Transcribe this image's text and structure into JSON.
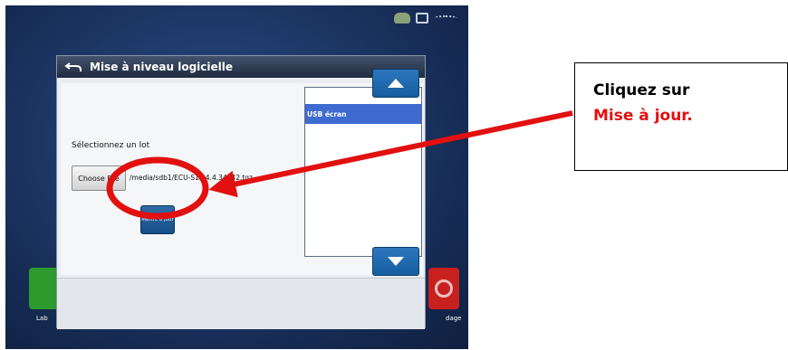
{
  "dialog": {
    "title": "Mise à niveau logicielle",
    "select_label": "Sélectionnez un lot",
    "choose_file_label": "Choose File",
    "file_path": "/media/sdb1/ECU-S1-v4.4.34042.tgz",
    "update_button_label": "Mettre à jour",
    "help_symbol": "?",
    "list_items": [
      "USB écran"
    ]
  },
  "background": {
    "left_tile_label": "Lab",
    "right_tile_label": "dage"
  },
  "annotation": {
    "line1": "Cliquez sur",
    "line2": "Mise à jour.",
    "accent_color": "#e21010"
  },
  "icons": {
    "back": "back-arrow-icon",
    "up": "arrow-up-icon",
    "down": "arrow-down-icon",
    "help": "help-icon",
    "gps": "gps-icon",
    "display": "display-icon",
    "satellite": "satellite-signal-icon"
  }
}
